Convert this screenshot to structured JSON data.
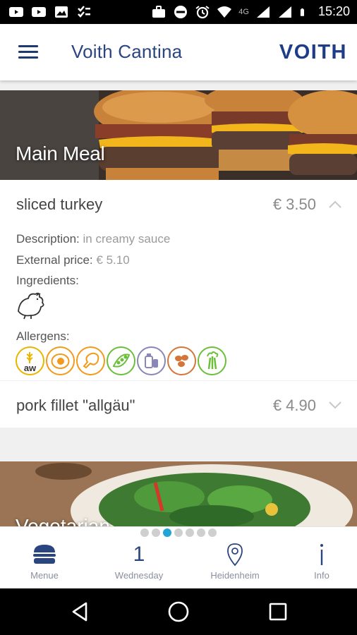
{
  "status_bar": {
    "time": "15:20",
    "network": "4G",
    "left_icons": [
      "youtube-icon",
      "youtube-icon",
      "image-icon",
      "checklist-icon"
    ],
    "right_icons": [
      "briefcase-icon",
      "do-not-disturb-icon",
      "alarm-icon",
      "wifi-icon",
      "signal-icon",
      "signal-icon",
      "battery-icon"
    ]
  },
  "app_bar": {
    "title": "Voith Cantina",
    "brand": "VOITH"
  },
  "sections": [
    {
      "title": "Main Meal"
    },
    {
      "title": "Vegetarian"
    }
  ],
  "dishes": [
    {
      "name": "sliced turkey",
      "price": "€ 3.50",
      "expanded": true,
      "description_label": "Description:",
      "description": "in creamy sauce",
      "external_price_label": "External price:",
      "external_price": "€ 5.10",
      "ingredients_label": "Ingredients:",
      "ingredients": [
        "poultry-icon"
      ],
      "allergens_label": "Allergens:",
      "allergens": [
        {
          "icon": "wheat-icon",
          "label": "aw",
          "color": "#e8b600"
        },
        {
          "icon": "egg-icon",
          "color": "#f29a1a"
        },
        {
          "icon": "chicken-leg-icon",
          "color": "#f29a1a"
        },
        {
          "icon": "soy-icon",
          "color": "#6cbf3a"
        },
        {
          "icon": "milk-icon",
          "color": "#8a86b8"
        },
        {
          "icon": "nuts-icon",
          "color": "#d4753a"
        },
        {
          "icon": "celery-icon",
          "color": "#6cbf3a"
        }
      ]
    },
    {
      "name": "pork fillet \"allgäu\"",
      "price": "€ 4.90",
      "expanded": false
    }
  ],
  "pager": {
    "count": 7,
    "active_index": 2
  },
  "bottom_nav": {
    "items": [
      {
        "label": "Menue",
        "icon": "burger-icon"
      },
      {
        "label": "Wednesday",
        "number": "1"
      },
      {
        "label": "Heidenheim",
        "icon": "location-pin-icon"
      },
      {
        "label": "Info",
        "icon": "info-icon"
      }
    ]
  },
  "colors": {
    "brand_blue": "#1e3c87",
    "accent_cyan": "#21a5d6",
    "price_gray": "#8a8a8a"
  }
}
